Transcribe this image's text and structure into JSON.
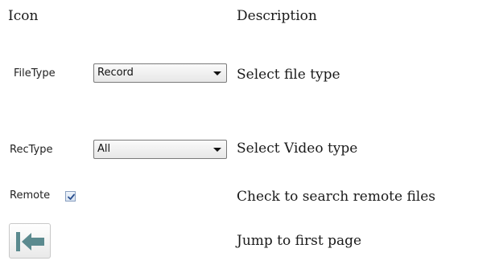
{
  "table": {
    "headers": {
      "icon": "Icon",
      "description": "Description"
    },
    "rows": [
      {
        "control": {
          "kind": "combo",
          "label": "FileType",
          "value": "Record"
        },
        "description": "Select file type"
      },
      {
        "control": {
          "kind": "combo",
          "label": "RecType",
          "value": "All"
        },
        "description": "Select Video type"
      },
      {
        "control": {
          "kind": "checkbox",
          "label": "Remote",
          "checked": true
        },
        "description": "Check to search remote files"
      },
      {
        "control": {
          "kind": "button",
          "icon": "first-page-icon"
        },
        "description": "Jump to first page"
      }
    ]
  },
  "colors": {
    "text": "#1a1a1a",
    "arrow_icon": "#5b8a8f",
    "checkmark": "#2a4f8f"
  }
}
